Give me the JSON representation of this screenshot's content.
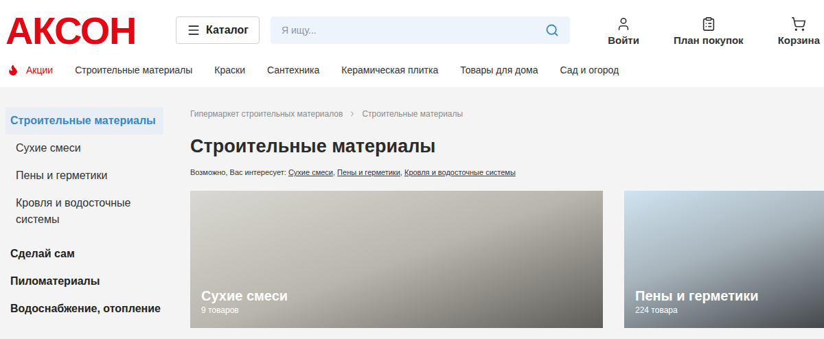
{
  "header": {
    "logo": "АКСОН",
    "catalog_button": "Каталог",
    "search": {
      "placeholder": "Я ищу..."
    },
    "actions": [
      {
        "label": "Войти",
        "icon": "user"
      },
      {
        "label": "План покупок",
        "icon": "clipboard"
      },
      {
        "label": "Корзина",
        "icon": "cart"
      }
    ]
  },
  "nav": {
    "promo": "Акции",
    "items": [
      "Строительные материалы",
      "Краски",
      "Сантехника",
      "Керамическая плитка",
      "Товары для дома",
      "Сад и огород"
    ]
  },
  "sidebar": {
    "items": [
      {
        "label": "Строительные материалы",
        "kind": "category",
        "selected": true
      },
      {
        "label": "Сухие смеси",
        "kind": "subcategory",
        "selected": false
      },
      {
        "label": "Пены и герметики",
        "kind": "subcategory",
        "selected": false
      },
      {
        "label": "Кровля и водосточные системы",
        "kind": "subcategory",
        "selected": false
      },
      {
        "label": "Сделай сам",
        "kind": "category",
        "selected": false
      },
      {
        "label": "Пиломатериалы",
        "kind": "category",
        "selected": false
      },
      {
        "label": "Водоснабжение, отопление",
        "kind": "category",
        "selected": false
      }
    ]
  },
  "breadcrumbs": [
    "Гипермаркет строительных материалов",
    "Строительные материалы"
  ],
  "title": "Строительные материалы",
  "suggestions": {
    "label": "Возможно, Вас интересует:",
    "links": [
      "Сухие смеси",
      "Пены и герметики",
      "Кровля и водосточные системы"
    ]
  },
  "cards": [
    {
      "title": "Сухие смеси",
      "count": "9 товаров"
    },
    {
      "title": "Пены и герметики",
      "count": "224 товара"
    }
  ]
}
